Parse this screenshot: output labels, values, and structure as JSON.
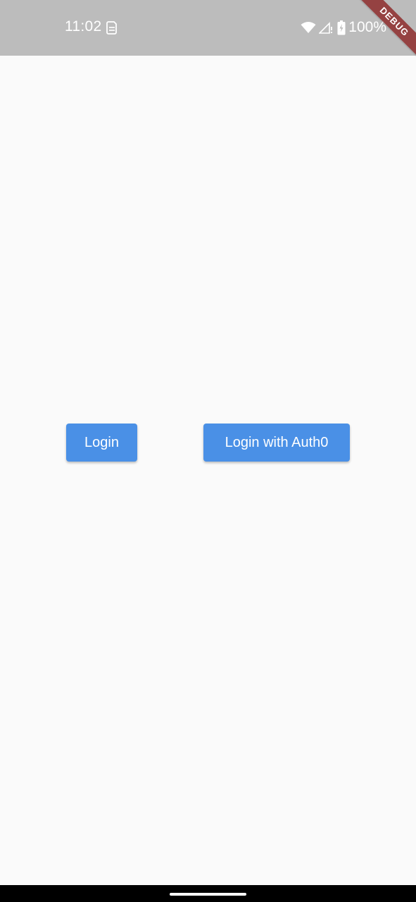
{
  "status_bar": {
    "time": "11:02",
    "battery": "100%",
    "app_icon": "sim-card-icon",
    "wifi_icon": "wifi-icon",
    "signal_icon": "signal-icon",
    "battery_icon": "battery-charging-icon"
  },
  "debug_banner": {
    "label": "DEBUG"
  },
  "main": {
    "login_label": "Login",
    "auth0_label": "Login with Auth0"
  },
  "colors": {
    "status_bar": "#bcbcbc",
    "background": "#fafafa",
    "button": "#4a90e6",
    "button_text": "#ffffff",
    "debug_banner": "#8b3a3a",
    "nav_bar": "#000000"
  }
}
